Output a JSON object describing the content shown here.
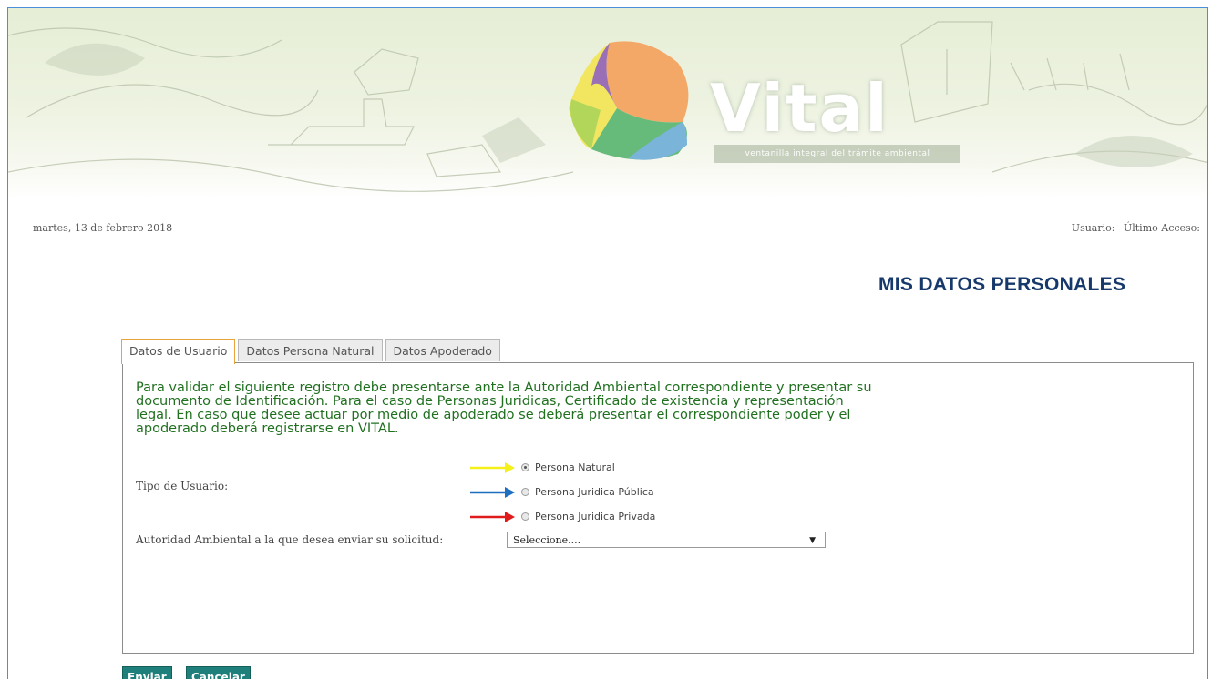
{
  "header": {
    "logo_text": "Vital",
    "logo_subtitle": "ventanilla integral del trámite ambiental"
  },
  "topbar": {
    "date": "martes, 13 de febrero 2018",
    "user_label": "Usuario:",
    "last_access_label": "Último Acceso:"
  },
  "page": {
    "title": "MIS DATOS PERSONALES"
  },
  "tabs": [
    {
      "label": "Datos de Usuario",
      "active": true
    },
    {
      "label": "Datos Persona Natural",
      "active": false
    },
    {
      "label": "Datos Apoderado",
      "active": false
    }
  ],
  "form": {
    "notice": "Para validar el siguiente registro debe presentarse ante la Autoridad Ambiental correspondiente y presentar su documento de Identificación. Para el caso de Personas Juridicas, Certificado de existencia y representación legal. En caso que desee actuar por medio de apoderado se deberá presentar el correspondiente poder y el apoderado deberá registrarse en VITAL.",
    "user_type_label": "Tipo de Usuario:",
    "user_type_options": [
      {
        "label": "Persona Natural",
        "checked": true,
        "arrow_color": "#f5ef1a"
      },
      {
        "label": "Persona Juridica Pública",
        "checked": false,
        "arrow_color": "#1e6fc0"
      },
      {
        "label": "Persona Juridica Privada",
        "checked": false,
        "arrow_color": "#e01b1b"
      }
    ],
    "authority_label": "Autoridad Ambiental a la que desea enviar su solicitud:",
    "authority_selected": "Seleccione....",
    "submit_label": "Enviar",
    "cancel_label": "Cancelar"
  },
  "colors": {
    "title": "#16386a",
    "notice_text": "#207020",
    "button": "#1f7f7a",
    "active_tab_border": "#e9a33a"
  }
}
